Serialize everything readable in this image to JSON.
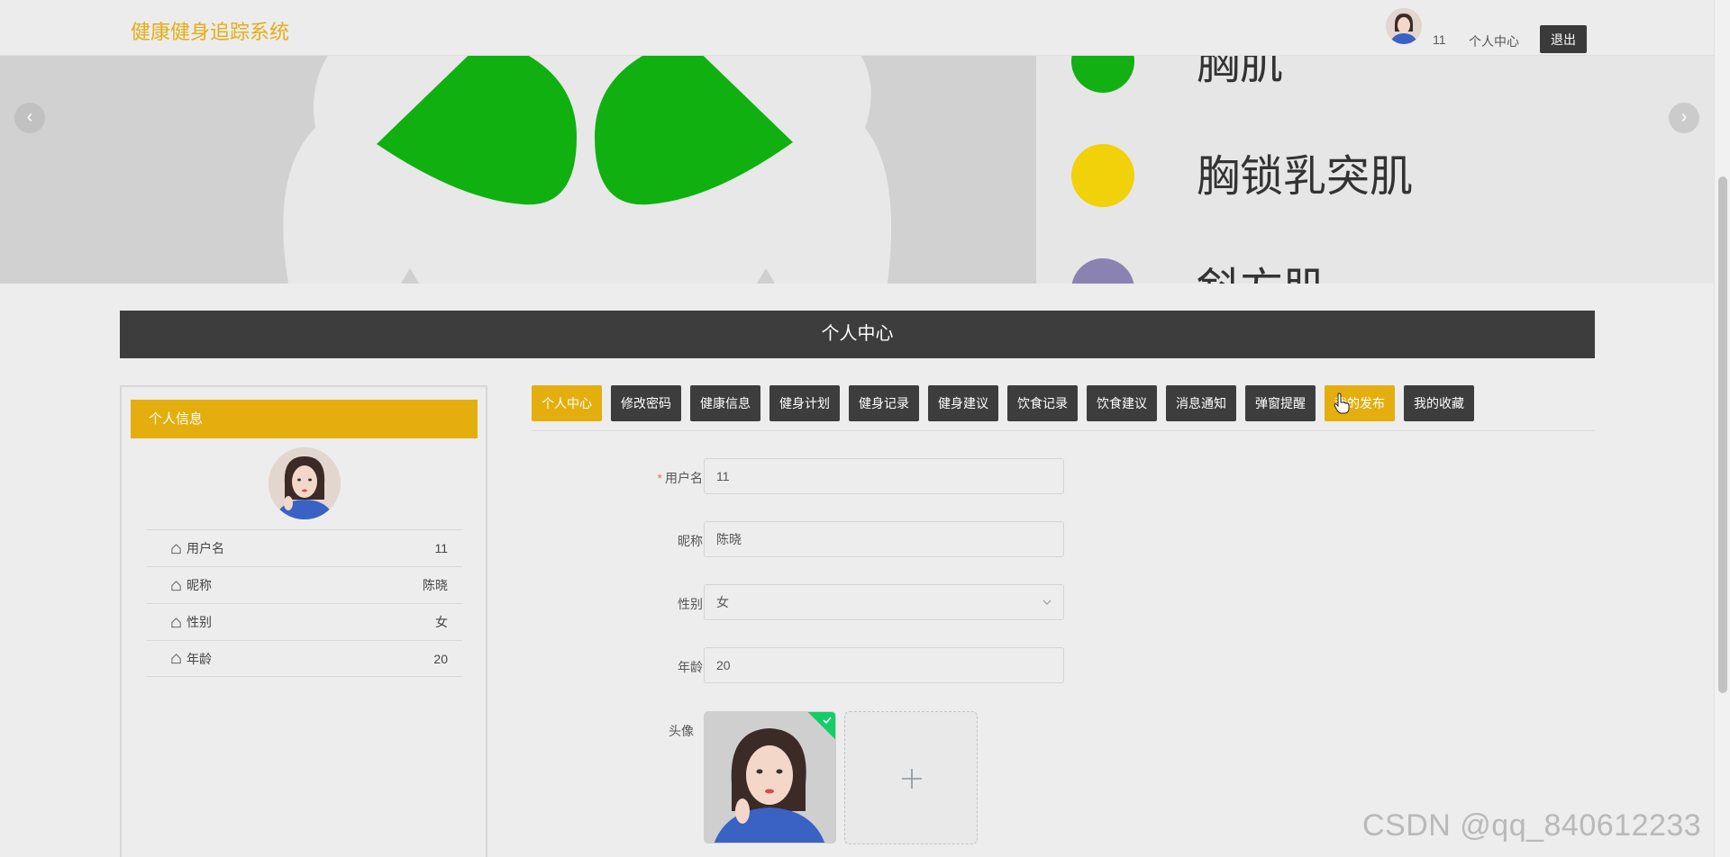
{
  "header": {
    "brand": "健康健身追踪系统",
    "username": "11",
    "personal_center": "个人中心",
    "logout": "退出"
  },
  "banner": {
    "labels": [
      "胸肌",
      "胸锁乳突肌",
      "斜方肌"
    ],
    "colors": [
      "#12b012",
      "#f0d10a",
      "#8a82b0"
    ]
  },
  "section": {
    "title": "个人中心"
  },
  "sidebar": {
    "title": "个人信息",
    "items": [
      {
        "key": "用户名",
        "value": "11"
      },
      {
        "key": "昵称",
        "value": "陈晓"
      },
      {
        "key": "性别",
        "value": "女"
      },
      {
        "key": "年龄",
        "value": "20"
      }
    ]
  },
  "tabs": [
    {
      "label": "个人中心",
      "active": true
    },
    {
      "label": "修改密码"
    },
    {
      "label": "健康信息"
    },
    {
      "label": "健身计划"
    },
    {
      "label": "健身记录"
    },
    {
      "label": "健身建议"
    },
    {
      "label": "饮食记录"
    },
    {
      "label": "饮食建议"
    },
    {
      "label": "消息通知"
    },
    {
      "label": "弹窗提醒"
    },
    {
      "label": "我的发布",
      "active": true
    },
    {
      "label": "我的收藏"
    }
  ],
  "form": {
    "username_label": "用户名",
    "username_value": "11",
    "nickname_label": "昵称",
    "nickname_value": "陈晓",
    "gender_label": "性别",
    "gender_value": "女",
    "age_label": "年龄",
    "age_value": "20",
    "avatar_label": "头像"
  },
  "watermark": "CSDN @qq_840612233",
  "colors": {
    "accent": "#e4ae0e",
    "dark": "#3d3d3d",
    "success": "#13ce66"
  }
}
